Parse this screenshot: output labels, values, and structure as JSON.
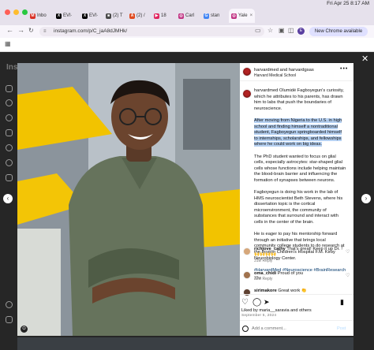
{
  "browser": {
    "tabs": [
      {
        "label": "Inbo",
        "color": "#d93025",
        "glyph": "M"
      },
      {
        "label": "EVI·",
        "color": "#000000",
        "glyph": "X"
      },
      {
        "label": "EVI·",
        "color": "#000000",
        "glyph": "X"
      },
      {
        "label": "(2) T",
        "color": "#4a4a4a",
        "glyph": "■"
      },
      {
        "label": "(2) /",
        "color": "#e04a1f",
        "glyph": "A"
      },
      {
        "label": "18 ",
        "color": "#e0245e",
        "glyph": "▶"
      },
      {
        "label": "Carl",
        "color": "#c13584",
        "glyph": "◎"
      },
      {
        "label": "stan",
        "color": "#4285f4",
        "glyph": "G"
      },
      {
        "label": "Yale",
        "color": "#c13584",
        "glyph": "◎"
      }
    ],
    "clock": "Fri Apr 25  8:17 AM",
    "url": "instagram.com/p/C_jaA8dJMHk/",
    "profile_initial": "E",
    "new_chrome_label": "New Chrome available"
  },
  "background": {
    "left_logo_fragment": "Inst"
  },
  "post": {
    "header_name": "harvardmed and harvardgsas",
    "header_sub": "Harvard Medical School",
    "caption_intro": "harvardmed Olumidé Fagboyegun's curiosity, which he attributes to his parents, has drawn him to labs that push the boundaries of neuroscience.",
    "caption_highlight": "After moving from Nigeria to the U.S. in high school and finding himself a nontraditional student, Fagboyegun springboarded himself to internships, scholarships, and fellowships where he could work on big ideas.",
    "caption_p3": "The PhD student wanted to focus on glial cells, especially astrocytes: star-shaped glial cells whose functions include helping maintain the blood-brain barrier and influencing the formation of synapses between neurons.",
    "caption_p4": "Fagboyegun is doing his work in the lab of HMS neuroscientist Beth Stevens, where his dissertation topic is the cortical microenvironment, the community of substances that surround and interact with cells in the center of the brain.",
    "caption_p5": "He is eager to pay his mentorship forward through an initiative that brings local community college students to do research at the Boston Children's Hospital F.M. Kirby Neurobiology Center.",
    "hashtags": "#HarvardMed #Neuroscience #BrainResearch",
    "caption_ago": "33w",
    "comments": [
      {
        "user": "richlove_cathy",
        "text": "That's great! Keep it up Dr. ! 🙌🙌🙌🙌",
        "meta": "31w   Reply"
      },
      {
        "user": "oma_chidi",
        "text": "Proud of you",
        "meta": "32w   Reply"
      },
      {
        "user": "sirimakore",
        "text": "Great work 👏",
        "meta": ""
      }
    ],
    "liked_by": "Liked by maria__saravia and others",
    "date": "September 5, 2024",
    "add_comment_placeholder": "Add a comment...",
    "post_button": "Post",
    "photo_badge": "⊙"
  },
  "icons": {
    "like": "heart-icon",
    "comment": "comment-icon",
    "share": "send-icon",
    "save": "bookmark-icon"
  }
}
